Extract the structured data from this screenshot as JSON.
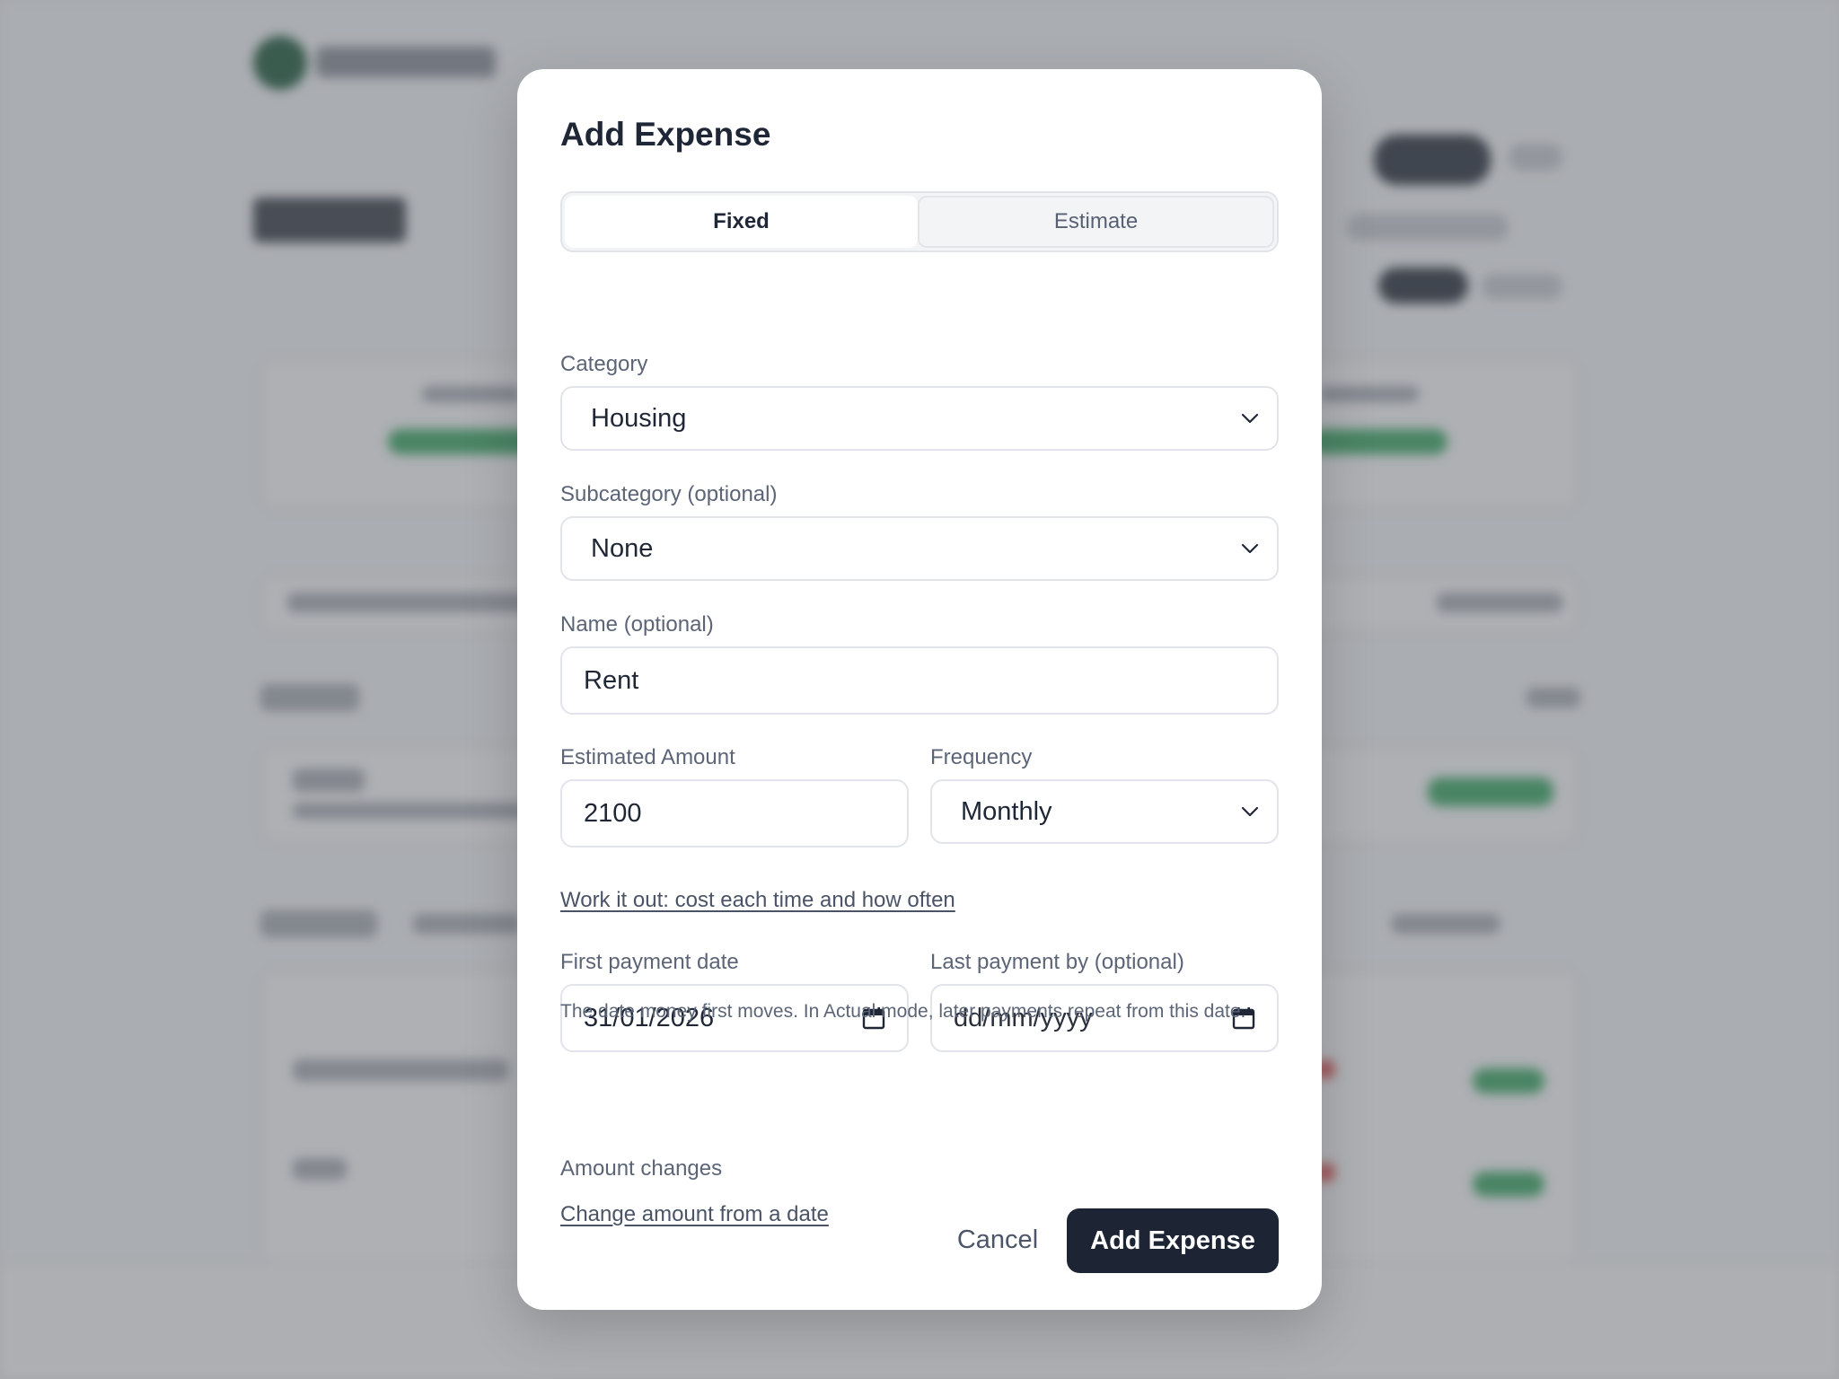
{
  "modal": {
    "title": "Add Expense",
    "segments": {
      "fixed": "Fixed",
      "estimate": "Estimate",
      "selected": "Fixed"
    },
    "category": {
      "label": "Category",
      "value": "Housing"
    },
    "subcategory": {
      "label": "Subcategory (optional)",
      "value": "None"
    },
    "name": {
      "label": "Name (optional)",
      "value": "Rent"
    },
    "amount": {
      "label": "Estimated Amount",
      "value": "2100"
    },
    "frequency": {
      "label": "Frequency",
      "value": "Monthly"
    },
    "work_it_out_link": "Work it out: cost each time and how often",
    "first_payment": {
      "label": "First payment date",
      "value": "31/01/2026"
    },
    "last_payment": {
      "label": "Last payment by (optional)",
      "placeholder": "dd/mm/yyyy"
    },
    "help_text": "The date money first moves. In Actual mode, later payments repeat from this date.",
    "amount_changes": {
      "label": "Amount changes",
      "link": "Change amount from a date"
    },
    "cancel_label": "Cancel",
    "submit_label": "Add Expense"
  },
  "colors": {
    "primary": "#1d2535",
    "text": "#1f2737",
    "muted": "#5c6577",
    "border": "#e1e4e9"
  }
}
